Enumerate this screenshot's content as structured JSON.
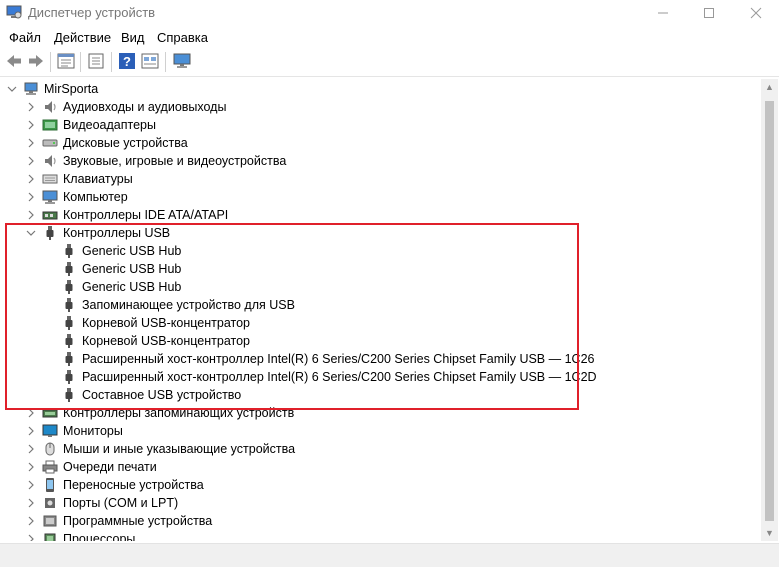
{
  "window": {
    "title": "Диспетчер устройств",
    "controls": [
      "minimize-icon",
      "maximize-icon",
      "close-icon"
    ]
  },
  "menu": [
    "Файл",
    "Действие",
    "Вид",
    "Справка"
  ],
  "toolbar": [
    "back-icon",
    "forward-icon",
    "properties-icon",
    "update-driver-icon",
    "help-icon",
    "view-icon",
    "monitor-scan-icon"
  ],
  "tree": {
    "root": "MirSporta",
    "categories": [
      {
        "label": "Аудиовходы и аудиовыходы",
        "icon": "speaker-icon",
        "expanded": false
      },
      {
        "label": "Видеоадаптеры",
        "icon": "display-adapter-icon",
        "expanded": false
      },
      {
        "label": "Дисковые устройства",
        "icon": "disk-drive-icon",
        "expanded": false
      },
      {
        "label": "Звуковые, игровые и видеоустройства",
        "icon": "speaker-icon",
        "expanded": false
      },
      {
        "label": "Клавиатуры",
        "icon": "keyboard-icon",
        "expanded": false
      },
      {
        "label": "Компьютер",
        "icon": "computer-icon",
        "expanded": false
      },
      {
        "label": "Контроллеры IDE ATA/ATAPI",
        "icon": "ide-controller-icon",
        "expanded": false
      },
      {
        "label": "Контроллеры USB",
        "icon": "usb-icon",
        "expanded": true,
        "children": [
          "Generic USB Hub",
          "Generic USB Hub",
          "Generic USB Hub",
          "Запоминающее устройство для USB",
          "Корневой USB-концентратор",
          "Корневой USB-концентратор",
          "Расширенный хост-контроллер Intel(R) 6 Series/C200 Series Chipset Family USB — 1C26",
          "Расширенный хост-контроллер Intel(R) 6 Series/C200 Series Chipset Family USB — 1C2D",
          "Составное USB устройство"
        ]
      },
      {
        "label": "Контроллеры запоминающих устройств",
        "icon": "storage-controller-icon",
        "expanded": false
      },
      {
        "label": "Мониторы",
        "icon": "monitor-icon",
        "expanded": false
      },
      {
        "label": "Мыши и иные указывающие устройства",
        "icon": "mouse-icon",
        "expanded": false
      },
      {
        "label": "Очереди печати",
        "icon": "printer-icon",
        "expanded": false
      },
      {
        "label": "Переносные устройства",
        "icon": "portable-device-icon",
        "expanded": false
      },
      {
        "label": "Порты (COM и LPT)",
        "icon": "port-icon",
        "expanded": false
      },
      {
        "label": "Программные устройства",
        "icon": "software-device-icon",
        "expanded": false
      },
      {
        "label": "Процессоры",
        "icon": "processor-icon",
        "expanded": false
      }
    ]
  },
  "colors": {
    "highlight": "#e0202a",
    "usb_icon": "#555555",
    "monitor_blue": "#1e88c8"
  }
}
